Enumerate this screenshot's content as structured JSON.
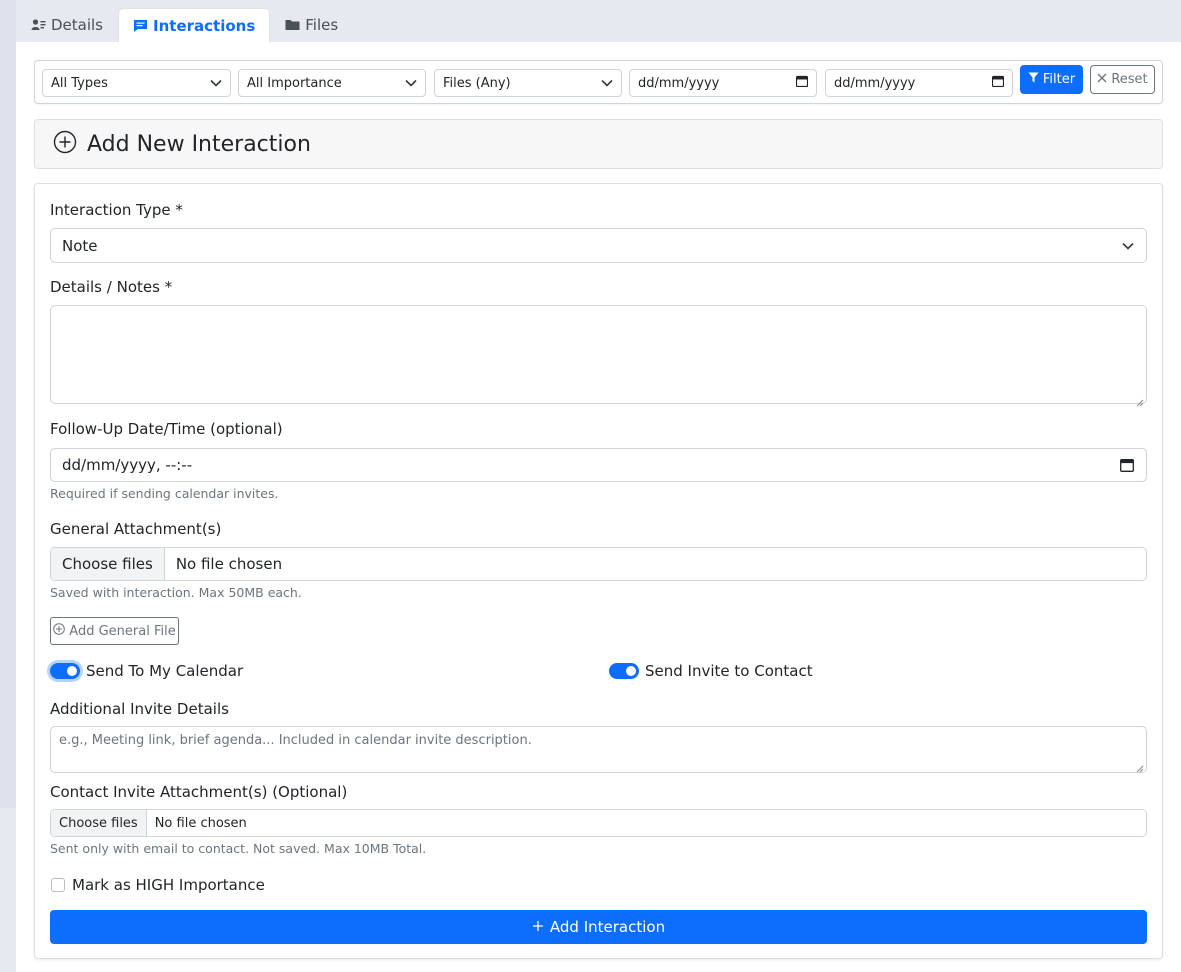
{
  "tabs": [
    {
      "label": "Details",
      "icon": "user-card-icon",
      "active": false
    },
    {
      "label": "Interactions",
      "icon": "chat-icon",
      "active": true
    },
    {
      "label": "Files",
      "icon": "folder-icon",
      "active": false
    }
  ],
  "filters": {
    "type": "All Types",
    "importance": "All Importance",
    "files": "Files (Any)",
    "date_from": "dd/mm/yyyy",
    "date_to": "dd/mm/yyyy",
    "filter_label": "Filter",
    "reset_label": "Reset"
  },
  "add_section": {
    "title": "Add New Interaction"
  },
  "form": {
    "type_label": "Interaction Type *",
    "type_value": "Note",
    "details_label": "Details / Notes *",
    "followup_label": "Follow-Up Date/Time (optional)",
    "followup_value": "dd/mm/yyyy, --:--",
    "followup_help": "Required if sending calendar invites.",
    "general_attach_label": "General Attachment(s)",
    "choose_files": "Choose files",
    "no_file": "No file chosen",
    "general_attach_help": "Saved with interaction. Max 50MB each.",
    "add_general_file": "Add General File",
    "send_calendar": "Send To My Calendar",
    "send_invite": "Send Invite to Contact",
    "invite_details_label": "Additional Invite Details",
    "invite_details_placeholder": "e.g., Meeting link, brief agenda... Included in calendar invite description.",
    "contact_attach_label": "Contact Invite Attachment(s) (Optional)",
    "contact_attach_help": "Sent only with email to contact. Not saved. Max 10MB Total.",
    "high_importance": "Mark as HIGH Importance",
    "submit_label": "Add Interaction"
  },
  "colors": {
    "primary": "#0d6efd",
    "secondary": "#6c757d"
  }
}
